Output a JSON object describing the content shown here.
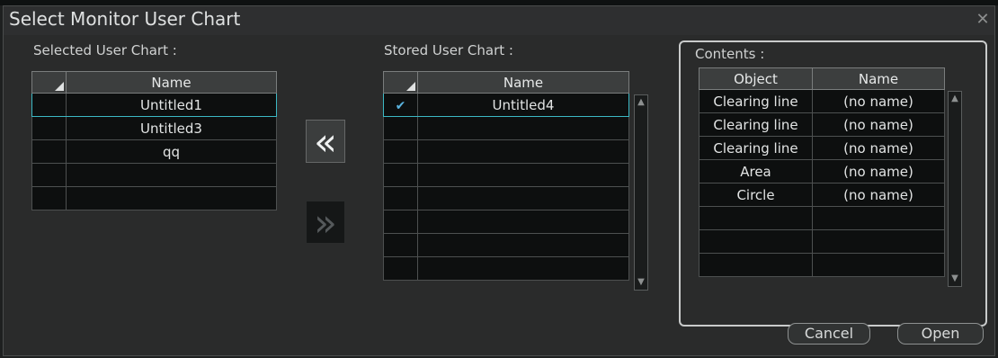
{
  "dialog": {
    "title": "Select Monitor User Chart",
    "close_icon": "close-icon"
  },
  "selected_chart": {
    "label": "Selected User Chart :",
    "column_header": "Name",
    "rows": [
      "Untitled1",
      "Untitled3",
      "qq",
      "",
      ""
    ],
    "selected_index": 0
  },
  "stored_chart": {
    "label": "Stored User Chart :",
    "column_header": "Name",
    "rows": [
      {
        "checked": true,
        "name": "Untitled4"
      },
      {
        "checked": false,
        "name": ""
      },
      {
        "checked": false,
        "name": ""
      },
      {
        "checked": false,
        "name": ""
      },
      {
        "checked": false,
        "name": ""
      },
      {
        "checked": false,
        "name": ""
      },
      {
        "checked": false,
        "name": ""
      },
      {
        "checked": false,
        "name": ""
      }
    ],
    "selected_index": 0
  },
  "move_buttons": {
    "move_left_glyph": "«",
    "move_right_glyph": "»"
  },
  "contents": {
    "label": "Contents :",
    "headers": [
      "Object",
      "Name"
    ],
    "rows": [
      [
        "Clearing line",
        "(no name)"
      ],
      [
        "Clearing line",
        "(no name)"
      ],
      [
        "Clearing line",
        "(no name)"
      ],
      [
        "Area",
        "(no name)"
      ],
      [
        "Circle",
        "(no name)"
      ],
      [
        "",
        ""
      ],
      [
        "",
        ""
      ],
      [
        "",
        ""
      ]
    ]
  },
  "buttons": {
    "cancel": "Cancel",
    "open": "Open"
  },
  "colors": {
    "background": "#2a2b2b",
    "selection_border": "#3cb8c4",
    "check_mark": "#5ab4e0"
  }
}
